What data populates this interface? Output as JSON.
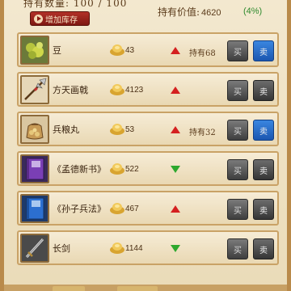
{
  "header": {
    "hold_quantity": "持有数量: 100 / 100",
    "expand_button": "增加库存",
    "hold_value_label": "持有价值:",
    "hold_value": "4620",
    "hold_value_change": "(4%)"
  },
  "items": [
    {
      "name": "豆",
      "price": "43",
      "trend": "up",
      "owned": "持有68",
      "buy": "买",
      "sell": "卖",
      "sell_active": true,
      "icon": "beans-icon"
    },
    {
      "name": "方天画戟",
      "price": "4123",
      "trend": "up",
      "owned": "",
      "buy": "买",
      "sell": "卖",
      "sell_active": false,
      "icon": "halberd-icon"
    },
    {
      "name": "兵粮丸",
      "price": "53",
      "trend": "up",
      "owned": "持有32",
      "buy": "买",
      "sell": "卖",
      "sell_active": true,
      "icon": "ration-bag-icon"
    },
    {
      "name": "《孟德新书》",
      "price": "522",
      "trend": "down",
      "owned": "",
      "buy": "买",
      "sell": "卖",
      "sell_active": false,
      "icon": "purple-book-icon"
    },
    {
      "name": "《孙子兵法》",
      "price": "467",
      "trend": "up",
      "owned": "",
      "buy": "买",
      "sell": "卖",
      "sell_active": false,
      "icon": "blue-book-icon"
    },
    {
      "name": "长剑",
      "price": "1144",
      "trend": "down",
      "owned": "",
      "buy": "买",
      "sell": "卖",
      "sell_active": false,
      "icon": "sword-icon"
    }
  ],
  "colors": {
    "trend_up": "#d42020",
    "trend_down": "#2ea82e",
    "sell_active": "#2a6fcc",
    "expand_button": "#9e2620"
  }
}
